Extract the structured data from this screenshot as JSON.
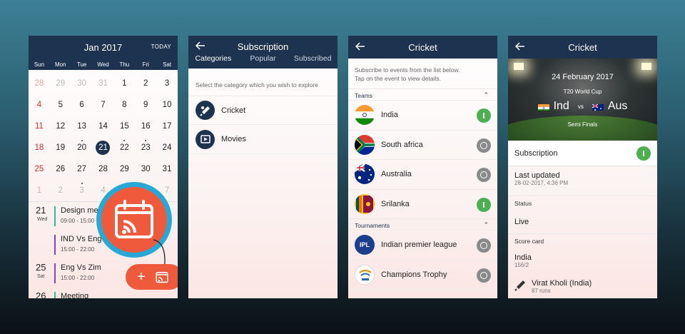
{
  "calendar": {
    "month_title": "Jan 2017",
    "today_label": "TODAY",
    "weekdays": [
      "Sun",
      "Mon",
      "Tue",
      "Wed",
      "Thu",
      "Fri",
      "Sat"
    ],
    "weeks": [
      [
        "28",
        "29",
        "30",
        "31",
        "1",
        "2",
        "3"
      ],
      [
        "4",
        "5",
        "6",
        "7",
        "8",
        "9",
        "10"
      ],
      [
        "11",
        "12",
        "13",
        "14",
        "15",
        "16",
        "17"
      ],
      [
        "18",
        "19",
        "20",
        "21",
        "22",
        "23",
        "24"
      ],
      [
        "25",
        "26",
        "27",
        "28",
        "29",
        "30",
        "31"
      ],
      [
        "1",
        "2",
        "3",
        "4",
        "5",
        "6",
        "7"
      ]
    ],
    "selected_day": "21",
    "events": [
      {
        "day": "21",
        "weekday": "Wed",
        "title": "Design me",
        "time": "09:00 - 15:00",
        "color": "#2fb99a"
      },
      {
        "day": "",
        "weekday": "",
        "title": "IND Vs Eng",
        "time": "15:00 - 22:00",
        "color": "#8e3fb5"
      },
      {
        "day": "25",
        "weekday": "Sat",
        "title": "Eng Vs Zim",
        "time": "15:00 - 22:00",
        "color": "#8e3fb5"
      },
      {
        "day": "26",
        "weekday": "",
        "title": "Meeting",
        "time": "",
        "color": "#2fb99a"
      }
    ],
    "fab_plus": "+"
  },
  "subscription": {
    "title": "Subscription",
    "tabs": [
      "Categories",
      "Popular",
      "Subscribed"
    ],
    "hint": "Select the category  which you wish to explore",
    "categories": [
      {
        "label": "Cricket",
        "icon": "cricket-icon"
      },
      {
        "label": "Movies",
        "icon": "movie-icon"
      }
    ]
  },
  "cricket_list": {
    "title": "Cricket",
    "intro_line1": "Subscribe to events from the list below.",
    "intro_line2": "Tap on the event to view details.",
    "teams_label": "Teams",
    "teams": [
      {
        "name": "India",
        "subscribed": true
      },
      {
        "name": "South africa",
        "subscribed": false
      },
      {
        "name": "Australia",
        "subscribed": false
      },
      {
        "name": "Srilanka",
        "subscribed": true
      }
    ],
    "tournaments_label": "Tournaments",
    "tournaments": [
      {
        "name": "Indian premier league",
        "subscribed": false,
        "logo_text": "IPL"
      },
      {
        "name": "Champions Trophy",
        "subscribed": false
      }
    ]
  },
  "cricket_detail": {
    "title": "Cricket",
    "match_date": "24 February 2017",
    "competition": "T20 World Cup",
    "team1": "Ind",
    "vs": "vs",
    "team2": "Aus",
    "round": "Semi Finals",
    "subscription_label": "Subscription",
    "last_updated_label": "Last updated",
    "last_updated_value": "28-02-2017, 4:36 PM",
    "status_label": "Status",
    "status_value": "Live",
    "scorecard_label": "Score card",
    "team_score_name": "India",
    "team_score": "156/2",
    "batsman": "Virat Kholi (India)",
    "batsman_runs": "87 runs"
  }
}
